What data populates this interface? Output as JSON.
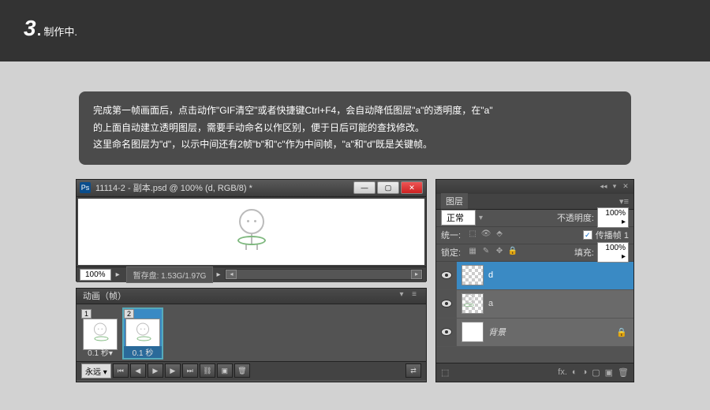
{
  "header": {
    "step_num": "3",
    "dot": ".",
    "title": "制作中."
  },
  "description": {
    "line1": "完成第一帧画面后，点击动作\"GIF清空\"或者快捷键Ctrl+F4，会自动降低图层\"a\"的透明度，在\"a\"",
    "line2": "的上面自动建立透明图层，需要手动命名以作区别，便于日后可能的查找修改。",
    "line3": "这里命名图层为\"d\"，以示中间还有2帧\"b\"和\"c\"作为中间帧，\"a\"和\"d\"既是关键帧。"
  },
  "doc_window": {
    "title": "11114-2 - 副本.psd @ 100% (d, RGB/8) *",
    "zoom": "100%",
    "scratch_label": "暂存盘:",
    "scratch_value": "1.53G/1.97G"
  },
  "animation": {
    "tab": "动画（帧）",
    "frames": [
      {
        "num": "1",
        "time": "0.1 秒▾"
      },
      {
        "num": "2",
        "time": "0.1 秒"
      }
    ],
    "loop": "永远 ▾"
  },
  "layers": {
    "tab": "图层",
    "blend_mode": "正常",
    "opacity_label": "不透明度:",
    "opacity_value": "100% ▸",
    "unify_label": "统一:",
    "propagate_label": "传播帧 1",
    "lock_label": "锁定:",
    "fill_label": "填充:",
    "fill_value": "100% ▸",
    "items": [
      {
        "name": "d",
        "selected": true,
        "bg": false
      },
      {
        "name": "a",
        "selected": false,
        "bg": false
      },
      {
        "name": "背景",
        "selected": false,
        "bg": true
      }
    ],
    "foot_link": "fx."
  }
}
